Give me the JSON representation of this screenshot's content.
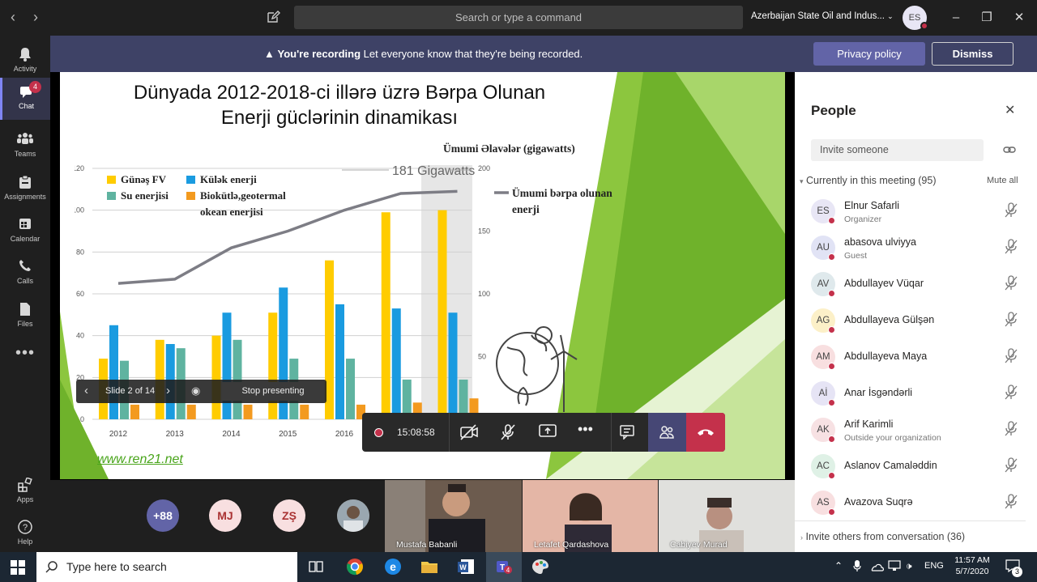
{
  "topbar": {
    "search_placeholder": "Search or type a command",
    "org_name": "Azerbaijan State Oil and Indus...",
    "user_initials": "ES"
  },
  "rail": {
    "items": [
      {
        "label": "Activity",
        "icon": "bell-icon"
      },
      {
        "label": "Chat",
        "icon": "chat-icon",
        "badge": "4"
      },
      {
        "label": "Teams",
        "icon": "teams-icon"
      },
      {
        "label": "Assignments",
        "icon": "assignments-icon"
      },
      {
        "label": "Calendar",
        "icon": "calendar-icon"
      },
      {
        "label": "Calls",
        "icon": "phone-icon"
      },
      {
        "label": "Files",
        "icon": "file-icon"
      },
      {
        "label": "Apps",
        "icon": "apps-icon"
      },
      {
        "label": "Help",
        "icon": "help-icon"
      }
    ]
  },
  "banner": {
    "bold": "You're recording",
    "text": "Let everyone know that they're being recorded.",
    "privacy_label": "Privacy policy",
    "dismiss_label": "Dismiss"
  },
  "slide": {
    "title_line1": "Dünyada 2012-2018-ci illərə üzrə Bərpa Olunan",
    "title_line2": "Enerji güclərinin dinamikası",
    "credit": "www.ren21.net",
    "counter": "Slide 2 of 14",
    "stop_label": "Stop presenting"
  },
  "chart_data": {
    "type": "bar",
    "categories": [
      "2012",
      "2013",
      "2014",
      "2015",
      "2016",
      "2017",
      "2018"
    ],
    "series": [
      {
        "name": "Günəş FV",
        "color": "#ffcc00",
        "values": [
          29,
          38,
          40,
          51,
          76,
          99,
          100
        ]
      },
      {
        "name": "Külək enerji",
        "color": "#1a9be0",
        "values": [
          45,
          36,
          51,
          63,
          55,
          53,
          51
        ]
      },
      {
        "name": "Su enerjisi",
        "color": "#5fb3a0",
        "values": [
          28,
          34,
          38,
          29,
          29,
          19,
          19
        ]
      },
      {
        "name": "Biokütlə,geotermal okean enerjisi",
        "color": "#f39a1f",
        "values": [
          7,
          7,
          7,
          7,
          7,
          8,
          10
        ]
      }
    ],
    "line": {
      "name": "Ümumi bərpa olunan enerji",
      "values": [
        65,
        67,
        82,
        90,
        100,
        108,
        109
      ]
    },
    "y_ticks_left": [
      "0",
      "20",
      "40",
      "60",
      "80",
      "100",
      "120"
    ],
    "y_ticks_right": [
      "50",
      "100",
      "150",
      "200"
    ],
    "right_axis_label": "Ümumi Əlavələr (gigawatts)",
    "annotation": "181 Gigawatts",
    "ylim": [
      0,
      120
    ]
  },
  "call": {
    "time": "15:08:58"
  },
  "strip": {
    "overflow": "+88",
    "avatars": [
      "MJ",
      "ZŞ"
    ],
    "videos": [
      "Mustafa Babanli",
      "Letafet Qardashova",
      "Cabiyev Murad"
    ]
  },
  "people": {
    "title": "People",
    "invite_placeholder": "Invite someone",
    "section": "Currently in this meeting (95)",
    "mute_all": "Mute all",
    "members": [
      {
        "initials": "ES",
        "name": "Elnur Safarli",
        "sub": "Organizer",
        "color": "#e8e6f5"
      },
      {
        "initials": "AU",
        "name": "abasova ulviyya",
        "sub": "Guest",
        "color": "#e1e3f5"
      },
      {
        "initials": "AV",
        "name": "Abdullayev Vüqar",
        "sub": "",
        "color": "#dfe9ec"
      },
      {
        "initials": "AG",
        "name": "Abdullayeva Gülşən",
        "sub": "",
        "color": "#fcf0c8"
      },
      {
        "initials": "AM",
        "name": "Abdullayeva Maya",
        "sub": "",
        "color": "#f8dfe0"
      },
      {
        "initials": "Aİ",
        "name": "Anar İsgəndərli",
        "sub": "",
        "color": "#e6e4f5"
      },
      {
        "initials": "AK",
        "name": "Arif Karimli",
        "sub": "Outside your organization",
        "color": "#f7e1e3"
      },
      {
        "initials": "AC",
        "name": "Aslanov Camaləddin",
        "sub": "",
        "color": "#dff1e6"
      },
      {
        "initials": "AS",
        "name": "Avazova Suqrə",
        "sub": "",
        "color": "#f8dfe0"
      }
    ],
    "footer": "Invite others from conversation (36)"
  },
  "taskbar": {
    "search_placeholder": "Type here to search",
    "time": "11:57 AM",
    "date": "5/7/2020",
    "lang": "ENG",
    "notif": "3"
  }
}
